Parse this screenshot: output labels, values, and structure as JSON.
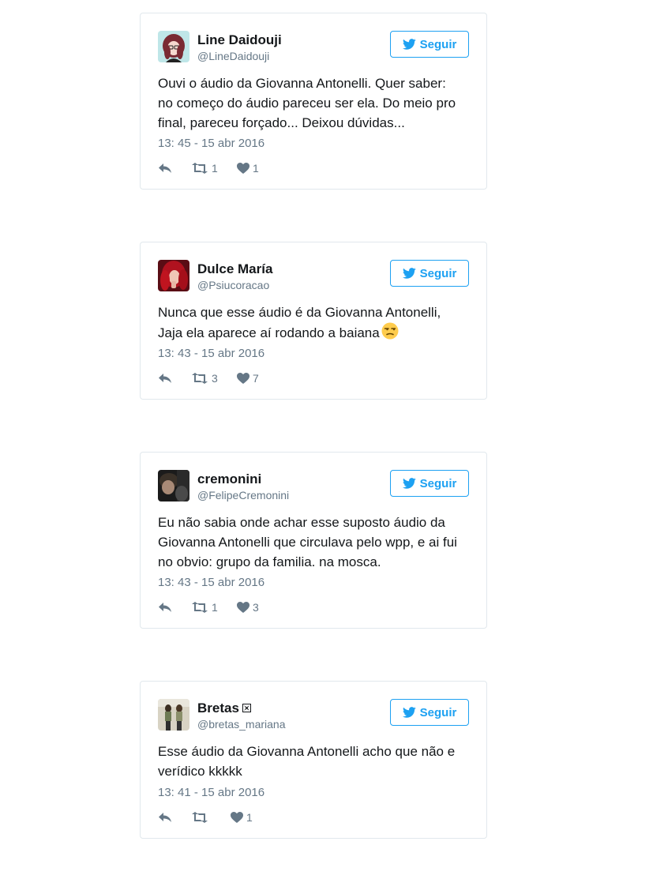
{
  "tweets": [
    {
      "name": "Line Daidouji",
      "handle": "@LineDaidouji",
      "follow_label": "Seguir",
      "text_lines": [
        "Ouvi o áudio da Giovanna Antonelli. Quer saber:",
        "no começo do áudio pareceu ser ela. Do meio pro",
        "final, pareceu forçado... Deixou dúvidas..."
      ],
      "timestamp": "13: 45 - 15 abr 2016",
      "retweets": "1",
      "likes": "1"
    },
    {
      "name": "Dulce María",
      "handle": "@Psiucoracao",
      "follow_label": "Seguir",
      "text_lines": [
        "Nunca que esse áudio é da Giovanna Antonelli,",
        "Jaja ela aparece aí rodando a baiana"
      ],
      "timestamp": "13: 43 - 15 abr 2016",
      "retweets": "3",
      "likes": "7"
    },
    {
      "name": "cremonini",
      "handle": "@FelipeCremonini",
      "follow_label": "Seguir",
      "text_lines": [
        "Eu não sabia onde achar esse suposto áudio da",
        "Giovanna Antonelli que circulava pelo wpp, e ai fui",
        "no obvio: grupo da familia. na mosca."
      ],
      "timestamp": "13: 43 - 15 abr 2016",
      "retweets": "1",
      "likes": "3"
    },
    {
      "name": "Bretas",
      "handle": "@bretas_mariana",
      "follow_label": "Seguir",
      "text_lines": [
        "Esse áudio da Giovanna Antonelli acho que não e",
        "verídico kkkkk"
      ],
      "timestamp": "13: 41 - 15 abr 2016",
      "retweets": "",
      "likes": "1"
    }
  ],
  "colors": {
    "twitter_blue": "#1da1f2",
    "secondary_text": "#657786",
    "border": "#e1e8ed"
  },
  "icons": {
    "follow": "twitter-bird-icon",
    "reply": "reply-icon",
    "retweet": "retweet-icon",
    "like": "heart-icon",
    "emoji": "unamused-face-emoji",
    "name_badge": "maltese-cross-icon"
  }
}
